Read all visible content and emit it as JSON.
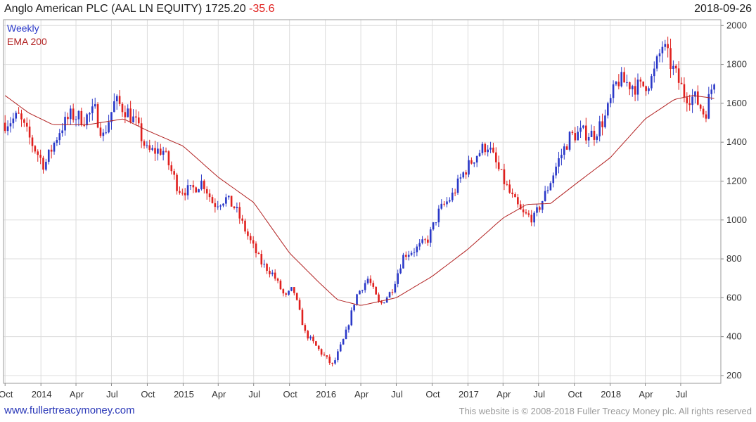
{
  "header": {
    "title": "Anglo American PLC (AAL LN EQUITY)",
    "last": "1725.20",
    "change": "-35.6",
    "date": "2018-09-26"
  },
  "footer": {
    "left": "www.fullertreacymoney.com",
    "right": "This website is © 2008-2018 Fuller Treacy Money plc. All rights reserved"
  },
  "colors": {
    "up": "#2a38c8",
    "down": "#e0201e",
    "ema": "#b22222",
    "grid": "#dcdcdc"
  },
  "chart_data": {
    "type": "candlestick",
    "legend": [
      "Weekly",
      "EMA 200"
    ],
    "legend_position": "top-left",
    "grid": true,
    "ylim": [
      160,
      2030
    ],
    "yticks": [
      200,
      400,
      600,
      800,
      1000,
      1200,
      1400,
      1600,
      1800,
      2000
    ],
    "xlim": [
      "2013-09-27",
      "2018-10-12"
    ],
    "xticks": [
      {
        "label": "Oct",
        "date": "2013-10-01"
      },
      {
        "label": "2014",
        "date": "2014-01-01"
      },
      {
        "label": "Apr",
        "date": "2014-04-01"
      },
      {
        "label": "Jul",
        "date": "2014-07-01"
      },
      {
        "label": "Oct",
        "date": "2014-10-01"
      },
      {
        "label": "2015",
        "date": "2015-01-01"
      },
      {
        "label": "Apr",
        "date": "2015-04-01"
      },
      {
        "label": "Jul",
        "date": "2015-07-01"
      },
      {
        "label": "Oct",
        "date": "2015-10-01"
      },
      {
        "label": "2016",
        "date": "2016-01-01"
      },
      {
        "label": "Apr",
        "date": "2016-04-01"
      },
      {
        "label": "Jul",
        "date": "2016-07-01"
      },
      {
        "label": "Oct",
        "date": "2016-10-01"
      },
      {
        "label": "2017",
        "date": "2017-01-01"
      },
      {
        "label": "Apr",
        "date": "2017-04-01"
      },
      {
        "label": "Jul",
        "date": "2017-07-01"
      },
      {
        "label": "Oct",
        "date": "2017-10-01"
      },
      {
        "label": "2018",
        "date": "2018-01-01"
      },
      {
        "label": "Apr",
        "date": "2018-04-01"
      },
      {
        "label": "Jul",
        "date": "2018-07-01"
      }
    ],
    "price_path": [
      [
        "2013-10-01",
        1500
      ],
      [
        "2013-11-05",
        1530
      ],
      [
        "2013-12-10",
        1390
      ],
      [
        "2014-01-10",
        1280
      ],
      [
        "2014-02-20",
        1470
      ],
      [
        "2014-03-20",
        1540
      ],
      [
        "2014-04-20",
        1520
      ],
      [
        "2014-05-20",
        1560
      ],
      [
        "2014-06-10",
        1430
      ],
      [
        "2014-07-10",
        1610
      ],
      [
        "2014-08-10",
        1560
      ],
      [
        "2014-09-01",
        1500
      ],
      [
        "2014-10-01",
        1350
      ],
      [
        "2014-11-10",
        1360
      ],
      [
        "2014-12-20",
        1160
      ],
      [
        "2015-01-20",
        1150
      ],
      [
        "2015-02-20",
        1200
      ],
      [
        "2015-03-20",
        1080
      ],
      [
        "2015-04-20",
        1110
      ],
      [
        "2015-05-15",
        1060
      ],
      [
        "2015-06-20",
        900
      ],
      [
        "2015-07-20",
        780
      ],
      [
        "2015-08-20",
        720
      ],
      [
        "2015-09-20",
        600
      ],
      [
        "2015-10-10",
        650
      ],
      [
        "2015-11-10",
        420
      ],
      [
        "2015-12-20",
        320
      ],
      [
        "2016-01-20",
        250
      ],
      [
        "2016-02-20",
        400
      ],
      [
        "2016-03-20",
        610
      ],
      [
        "2016-04-20",
        700
      ],
      [
        "2016-05-20",
        560
      ],
      [
        "2016-06-20",
        640
      ],
      [
        "2016-07-20",
        820
      ],
      [
        "2016-08-20",
        850
      ],
      [
        "2016-09-20",
        900
      ],
      [
        "2016-10-20",
        1050
      ],
      [
        "2016-11-20",
        1120
      ],
      [
        "2016-12-20",
        1240
      ],
      [
        "2017-01-20",
        1330
      ],
      [
        "2017-02-20",
        1390
      ],
      [
        "2017-03-20",
        1260
      ],
      [
        "2017-04-20",
        1130
      ],
      [
        "2017-05-20",
        1030
      ],
      [
        "2017-06-20",
        1010
      ],
      [
        "2017-07-20",
        1140
      ],
      [
        "2017-08-20",
        1300
      ],
      [
        "2017-09-20",
        1430
      ],
      [
        "2017-10-20",
        1450
      ],
      [
        "2017-11-20",
        1440
      ],
      [
        "2017-12-20",
        1530
      ],
      [
        "2018-01-20",
        1720
      ],
      [
        "2018-02-20",
        1700
      ],
      [
        "2018-03-20",
        1680
      ],
      [
        "2018-04-20",
        1730
      ],
      [
        "2018-05-15",
        1900
      ],
      [
        "2018-06-10",
        1780
      ],
      [
        "2018-07-10",
        1650
      ],
      [
        "2018-08-10",
        1620
      ],
      [
        "2018-09-01",
        1540
      ],
      [
        "2018-09-26",
        1740
      ]
    ],
    "ema_path": [
      [
        "2013-10-01",
        1640
      ],
      [
        "2013-12-01",
        1550
      ],
      [
        "2014-02-01",
        1490
      ],
      [
        "2014-05-01",
        1490
      ],
      [
        "2014-08-01",
        1520
      ],
      [
        "2014-10-01",
        1460
      ],
      [
        "2015-01-01",
        1380
      ],
      [
        "2015-04-01",
        1220
      ],
      [
        "2015-07-01",
        1090
      ],
      [
        "2015-10-01",
        830
      ],
      [
        "2015-12-15",
        680
      ],
      [
        "2016-02-01",
        590
      ],
      [
        "2016-04-01",
        560
      ],
      [
        "2016-07-01",
        600
      ],
      [
        "2016-10-01",
        710
      ],
      [
        "2017-01-01",
        850
      ],
      [
        "2017-04-01",
        1010
      ],
      [
        "2017-06-01",
        1080
      ],
      [
        "2017-08-01",
        1085
      ],
      [
        "2017-10-01",
        1180
      ],
      [
        "2018-01-01",
        1320
      ],
      [
        "2018-04-01",
        1520
      ],
      [
        "2018-06-15",
        1620
      ],
      [
        "2018-08-01",
        1640
      ],
      [
        "2018-09-26",
        1625
      ]
    ]
  }
}
